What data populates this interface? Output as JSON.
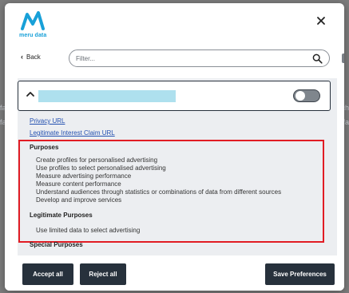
{
  "backdrop": {
    "left_fragments": [
      "fa",
      "fa"
    ],
    "right_fragments": [
      "ich",
      "fa"
    ]
  },
  "header": {
    "logo_text": "meru data",
    "brand_color": "#18a0d8",
    "close_icon": "close-icon"
  },
  "toolbar": {
    "back_label": "Back",
    "filter_placeholder": "Filter...",
    "search_icon": "search-icon"
  },
  "vendor": {
    "expanded": true,
    "toggle_on": false,
    "links": {
      "privacy": "Privacy URL",
      "legitimate_interest": "Legitimate Interest Claim URL"
    },
    "purposes_title": "Purposes",
    "purposes": [
      "Create profiles for personalised advertising",
      "Use profiles to select personalised advertising",
      "Measure advertising performance",
      "Measure content performance",
      "Understand audiences through statistics or combinations of data from different sources",
      "Develop and improve services"
    ],
    "legitimate_title": "Legitimate Purposes",
    "legitimate_purposes": [
      "Use limited data to select advertising"
    ],
    "special_title": "Special Purposes"
  },
  "footer": {
    "accept_label": "Accept all",
    "reject_label": "Reject all",
    "save_label": "Save Preferences"
  },
  "colors": {
    "button_bg": "#27313c",
    "highlight_border": "#e11c24",
    "link": "#2350b0"
  }
}
